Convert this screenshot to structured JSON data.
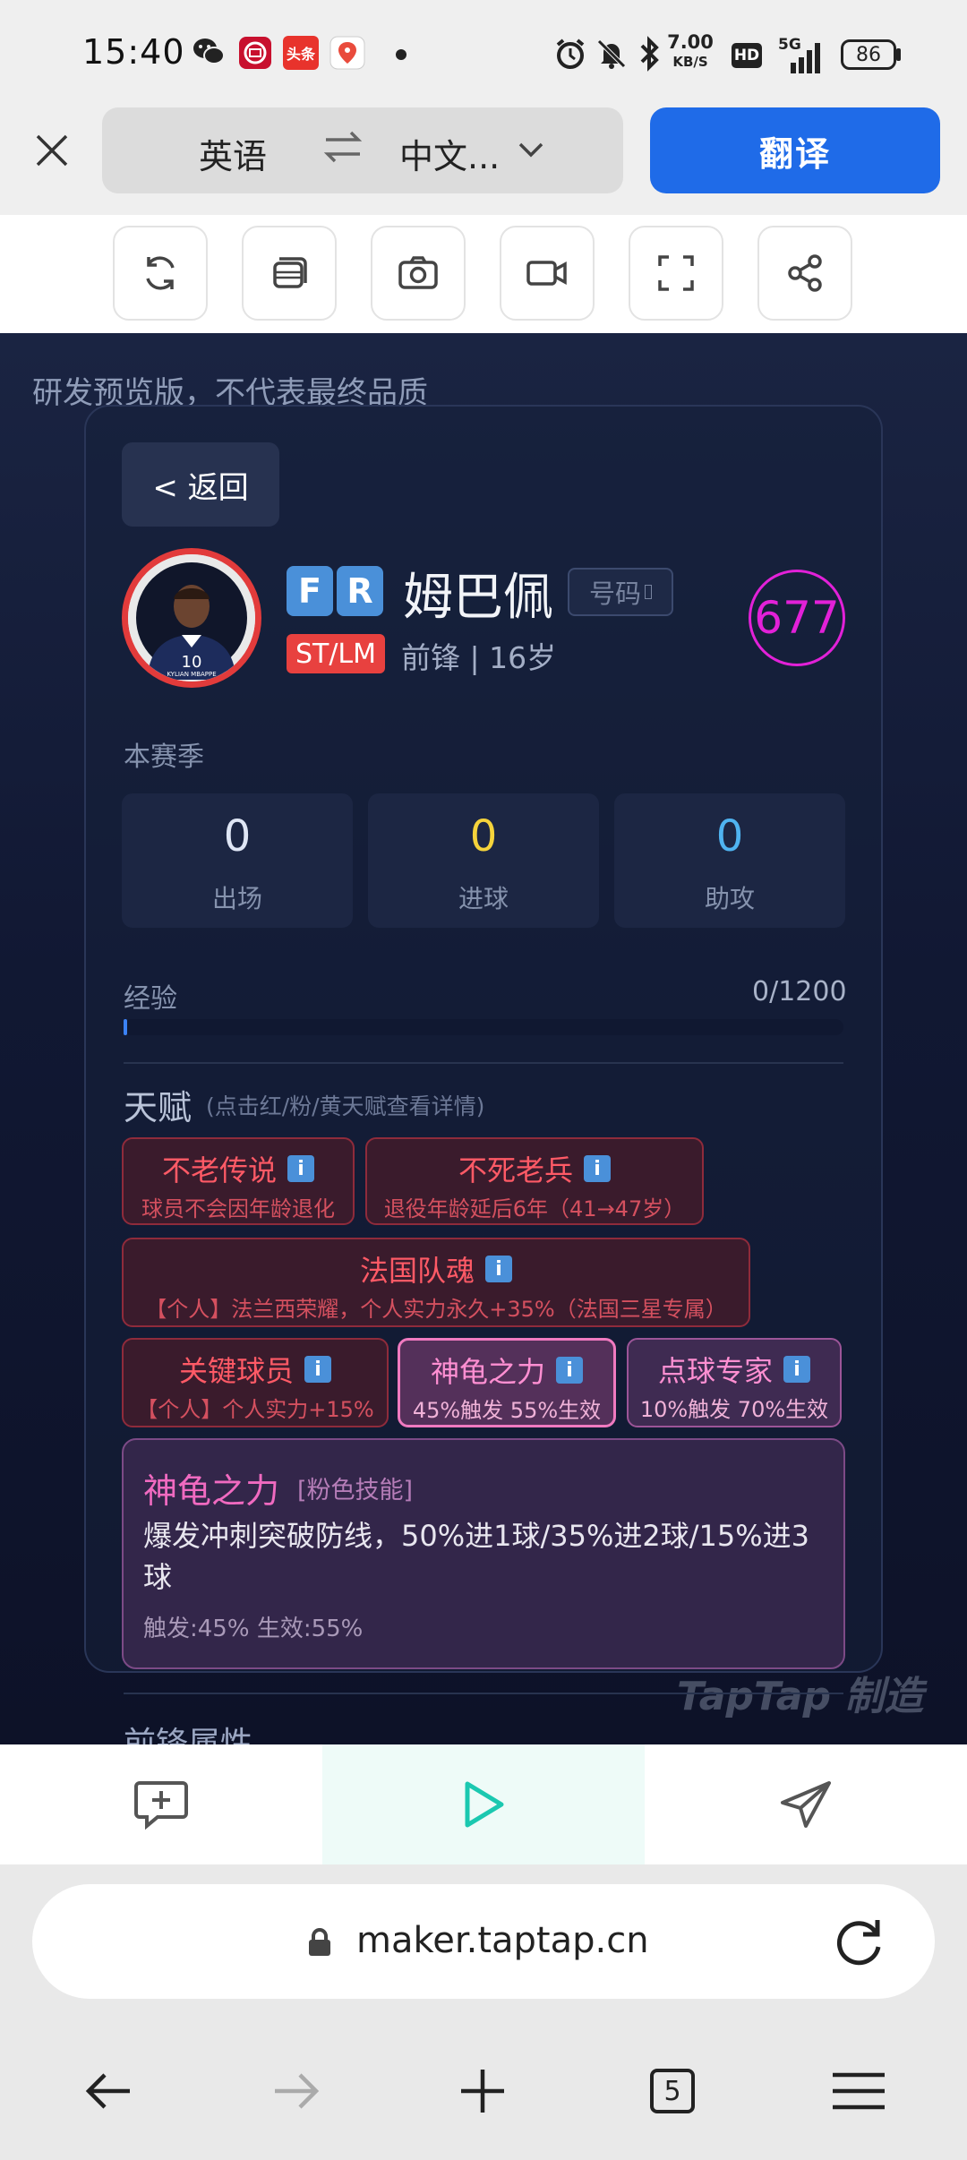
{
  "status_bar": {
    "time": "15:40",
    "net_speed_value": "7.00",
    "net_speed_unit": "KB/S",
    "hd": "HD",
    "signal": "5G",
    "battery": "86",
    "app_badge_toutiao": "头条"
  },
  "translate_bar": {
    "source_lang": "英语",
    "target_lang": "中文...",
    "translate_label": "翻译"
  },
  "toolbar": {
    "icons": [
      "refresh-icon",
      "copy-icon",
      "camera-icon",
      "video-icon",
      "fullscreen-icon",
      "share-icon"
    ]
  },
  "game": {
    "preview_note": "研发预览版，不代表最终品质",
    "back_label": "< 返回",
    "player": {
      "nationality_badges": [
        "F",
        "R"
      ],
      "name": "姆巴佩",
      "jersey_tag": "号码",
      "position": "ST/LM",
      "role_age": "前锋 | 16岁",
      "rating": "677",
      "avatar_caption": "KYLIAN MBAPPE",
      "avatar_number": "10"
    },
    "season": {
      "label": "本赛季",
      "stats": [
        {
          "value": "0",
          "label": "出场",
          "color": "#dfe6f5"
        },
        {
          "value": "0",
          "label": "进球",
          "color": "#f5d33b"
        },
        {
          "value": "0",
          "label": "助攻",
          "color": "#4fb3f0"
        }
      ]
    },
    "experience": {
      "label": "经验",
      "value": "0/1200",
      "progress": 0.0
    },
    "talents": {
      "title": "天赋",
      "hint": "(点击红/粉/黄天赋查看详情)",
      "info_glyph": "i",
      "items": [
        {
          "name": "不老传说",
          "desc": "球员不会因年龄退化",
          "tier": "red"
        },
        {
          "name": "不死老兵",
          "desc": "退役年龄延后6年（41→47岁）",
          "tier": "red"
        },
        {
          "name": "法国队魂",
          "desc": "【个人】法兰西荣耀，个人实力永久+35%（法国三星专属）",
          "tier": "red"
        },
        {
          "name": "关键球员",
          "desc": "【个人】个人实力+15%",
          "tier": "red"
        },
        {
          "name": "神龟之力",
          "desc": "45%触发 55%生效",
          "tier": "pink",
          "selected": true
        },
        {
          "name": "点球专家",
          "desc": "10%触发 70%生效",
          "tier": "pink"
        }
      ]
    },
    "skill_detail": {
      "name": "神龟之力",
      "type": "[粉色技能]",
      "description": "爆发冲刺突破防线，50%进1球/35%进2球/15%进3球",
      "stats": "触发:45%  生效:55%"
    },
    "watermark": "TapTap 制造",
    "next_section_peek": "前锋属性"
  },
  "action_bar": {
    "icons": [
      "comment-add-icon",
      "play-icon",
      "send-icon"
    ],
    "accent": "#1bc8b0"
  },
  "browser": {
    "url": "maker.taptap.cn",
    "tab_count": "5"
  }
}
